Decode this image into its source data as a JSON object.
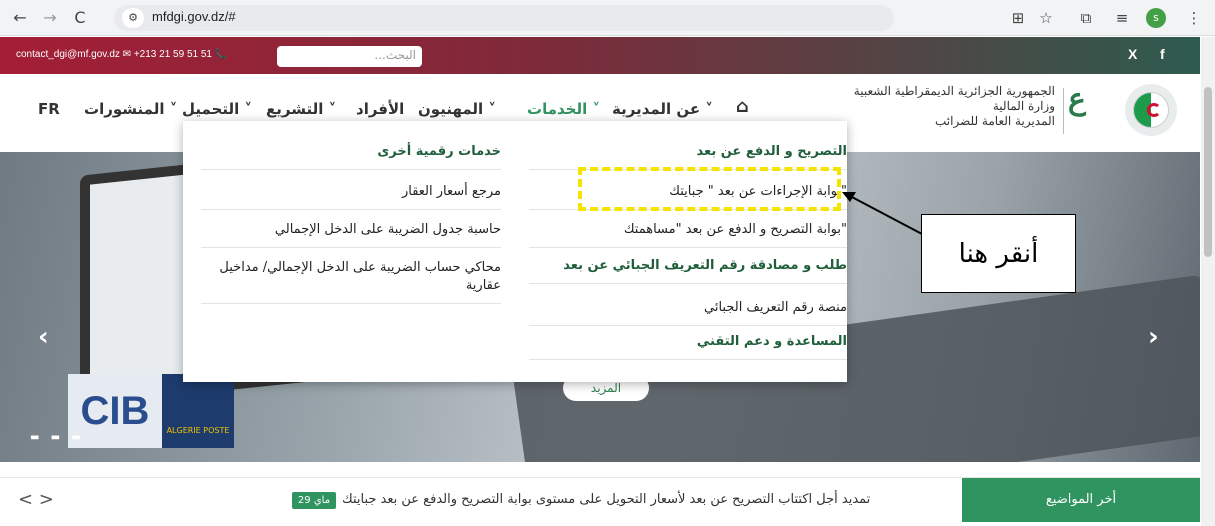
{
  "browser": {
    "url": "mfdgi.gov.dz/#",
    "back_icon": "←",
    "forward_icon": "→",
    "reload_icon": "C",
    "profile_initial": "s"
  },
  "topbar": {
    "contact": "contact_dgi@mf.gov.dz ✉  +213 21 59 51 51 📞",
    "search_placeholder": "البحث...",
    "x_label": "X",
    "fb_label": "f"
  },
  "nav": {
    "home_icon": "⌂",
    "about": "عن المديرية ˅",
    "services": "الخدمات ˅",
    "professionals": "المهنيون ˅",
    "individuals": "الأفراد",
    "legislation": "التشريع ˅",
    "downloads": "التحميل ˅",
    "publications": "المنشورات ˅",
    "lang": "FR"
  },
  "org": {
    "line1": "الجمهورية الجزائرية الديمقراطية الشعبية",
    "line2": "وزارة المالية",
    "line3": "المديرية العامة للضرائب",
    "emblem": "ع"
  },
  "dropdown": {
    "right_col": [
      "التصريح و الدفع عن بعد",
      "\"بوابة الإجراءات عن بعد \" جبايتك",
      "\"بوابة التصريح و الدفع عن بعد \"مساهمتك",
      "طلب و مصادقة رقم التعريف الجبائي عن بعد",
      "منصة رقم التعريف الجبائي",
      "المساعدة و دعم التقني"
    ],
    "left_col": [
      "خدمات رقمية أخرى",
      "مرجع أسعار العقار",
      "حاسبة جدول الضريبة على الدخل الإجمالي",
      "محاكي حساب الضريبة على الدخل الإجمالي/ مداخيل عقارية"
    ]
  },
  "callout": "أنقر هنا",
  "hero": {
    "more_label": "المزيد",
    "cib_logo": "CIB",
    "post_logo": "ALGERIE POSTE",
    "prev": "‹",
    "next": "›"
  },
  "ticker": {
    "latest_label": "أخر المواضيع",
    "date_badge": "29 ماي",
    "text": "تمديد أجل اكتتاب التصريح عن بعد لأسعار التحويل على مستوى بوابة التصريح والدفع عن بعد جبايتك",
    "arrows": "< >"
  }
}
